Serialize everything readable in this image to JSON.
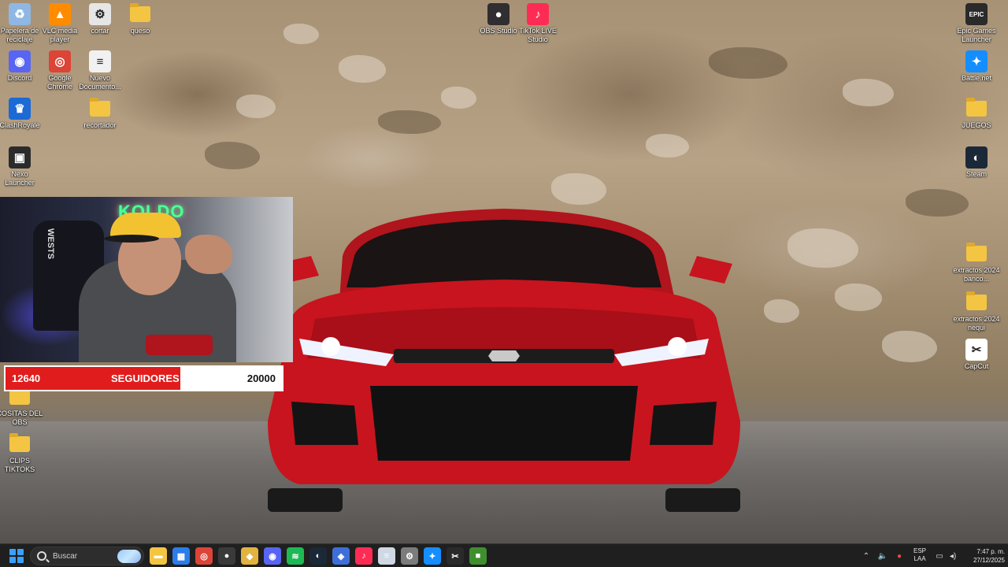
{
  "desktop": {
    "icons": [
      {
        "name": "recycle-bin-icon",
        "label": "Papelera de reciclaje",
        "glyph": "♻",
        "color": "#8fb7e3"
      },
      {
        "name": "vlc-icon",
        "label": "VLC media player",
        "glyph": "▲",
        "color": "#ff8c00"
      },
      {
        "name": "cortar-icon",
        "label": "cortar",
        "glyph": "⚙",
        "color": "#e6e6e6"
      },
      {
        "name": "queso-folder-icon",
        "label": "queso",
        "glyph": "",
        "color": "#f4c542"
      },
      {
        "name": "obs-studio-icon",
        "label": "OBS Studio",
        "glyph": "●",
        "color": "#302e31"
      },
      {
        "name": "tiktok-live-studio-icon",
        "label": "TikTok LIVE Studio",
        "glyph": "♪",
        "color": "#fe2c55"
      },
      {
        "name": "epic-games-icon",
        "label": "Epic Games Launcher",
        "glyph": "EPIC",
        "color": "#2a2a2a"
      },
      {
        "name": "discord-icon",
        "label": "Discord",
        "glyph": "◉",
        "color": "#5865f2"
      },
      {
        "name": "chrome-icon",
        "label": "Google Chrome",
        "glyph": "◎",
        "color": "#db4437"
      },
      {
        "name": "document-icon",
        "label": "Nuevo Documento...",
        "glyph": "≡",
        "color": "#f1f1f1"
      },
      {
        "name": "battlenet-icon",
        "label": "Battle.net",
        "glyph": "✦",
        "color": "#148eff"
      },
      {
        "name": "clash-royale-icon",
        "label": "ClashRoyale",
        "glyph": "♛",
        "color": "#1c6ad6"
      },
      {
        "name": "recortador-folder-icon",
        "label": "recortador",
        "glyph": "",
        "color": "#f4c542"
      },
      {
        "name": "juegos-folder-icon",
        "label": "JUEGOS",
        "glyph": "",
        "color": "#f4c542"
      },
      {
        "name": "nexo-launcher-icon",
        "label": "Nexo Launcher",
        "glyph": "▣",
        "color": "#2b2b2b"
      },
      {
        "name": "steam-icon",
        "label": "Steam",
        "glyph": "◐",
        "color": "#1b2838"
      },
      {
        "name": "extractos-banco-folder-icon",
        "label": "extractos 2024 banco...",
        "glyph": "",
        "color": "#f4c542"
      },
      {
        "name": "extractos-nequi-folder-icon",
        "label": "extractos 2024 nequi",
        "glyph": "",
        "color": "#f4c542"
      },
      {
        "name": "capcut-icon",
        "label": "CapCut",
        "glyph": "✂",
        "color": "#ffffff"
      },
      {
        "name": "cositas-obs-folder-icon",
        "label": "COSITAS DEL OBS",
        "glyph": "",
        "color": "#f4c542"
      },
      {
        "name": "clips-tiktoks-folder-icon",
        "label": "CLIPS TIKTOKS",
        "glyph": "",
        "color": "#f4c542"
      }
    ]
  },
  "webcam": {
    "neon_text": "KOLDO",
    "chair_text": "WESTS"
  },
  "follower_bar": {
    "current": "12640",
    "label": "SEGUIDORES",
    "goal": "20000",
    "progress": 0.632,
    "fill_color": "#e11c1c"
  },
  "taskbar": {
    "search_placeholder": "Buscar",
    "pinned": [
      {
        "name": "file-explorer-icon",
        "glyph": "▬",
        "color": "#f4c542"
      },
      {
        "name": "store-icon",
        "glyph": "▦",
        "color": "#2b7de9"
      },
      {
        "name": "chrome-taskbar-icon",
        "glyph": "◎",
        "color": "#db4437"
      },
      {
        "name": "obs-taskbar-icon",
        "glyph": "●",
        "color": "#3a3a3a"
      },
      {
        "name": "stack-app-icon",
        "glyph": "◆",
        "color": "#e3b341"
      },
      {
        "name": "discord-taskbar-icon",
        "glyph": "◉",
        "color": "#5865f2"
      },
      {
        "name": "spotify-icon",
        "glyph": "≋",
        "color": "#1db954"
      },
      {
        "name": "steam-taskbar-icon",
        "glyph": "◐",
        "color": "#1b2838"
      },
      {
        "name": "vpn-app-icon",
        "glyph": "◈",
        "color": "#3e6fd8"
      },
      {
        "name": "tiktok-taskbar-icon",
        "glyph": "♪",
        "color": "#fe2c55"
      },
      {
        "name": "notepad-icon",
        "glyph": "≡",
        "color": "#cfd8e3"
      },
      {
        "name": "settings-icon",
        "glyph": "⚙",
        "color": "#7c7c7c"
      },
      {
        "name": "battlenet-taskbar-icon",
        "glyph": "✦",
        "color": "#148eff"
      },
      {
        "name": "capcut-taskbar-icon",
        "glyph": "✂",
        "color": "#2a2a2a"
      },
      {
        "name": "minecraft-icon",
        "glyph": "■",
        "color": "#3f8f2f"
      }
    ],
    "tray": {
      "language_line1": "ESP",
      "language_line2": "LAA",
      "time": "7:47 p. m.",
      "date": "27/12/2025"
    }
  }
}
